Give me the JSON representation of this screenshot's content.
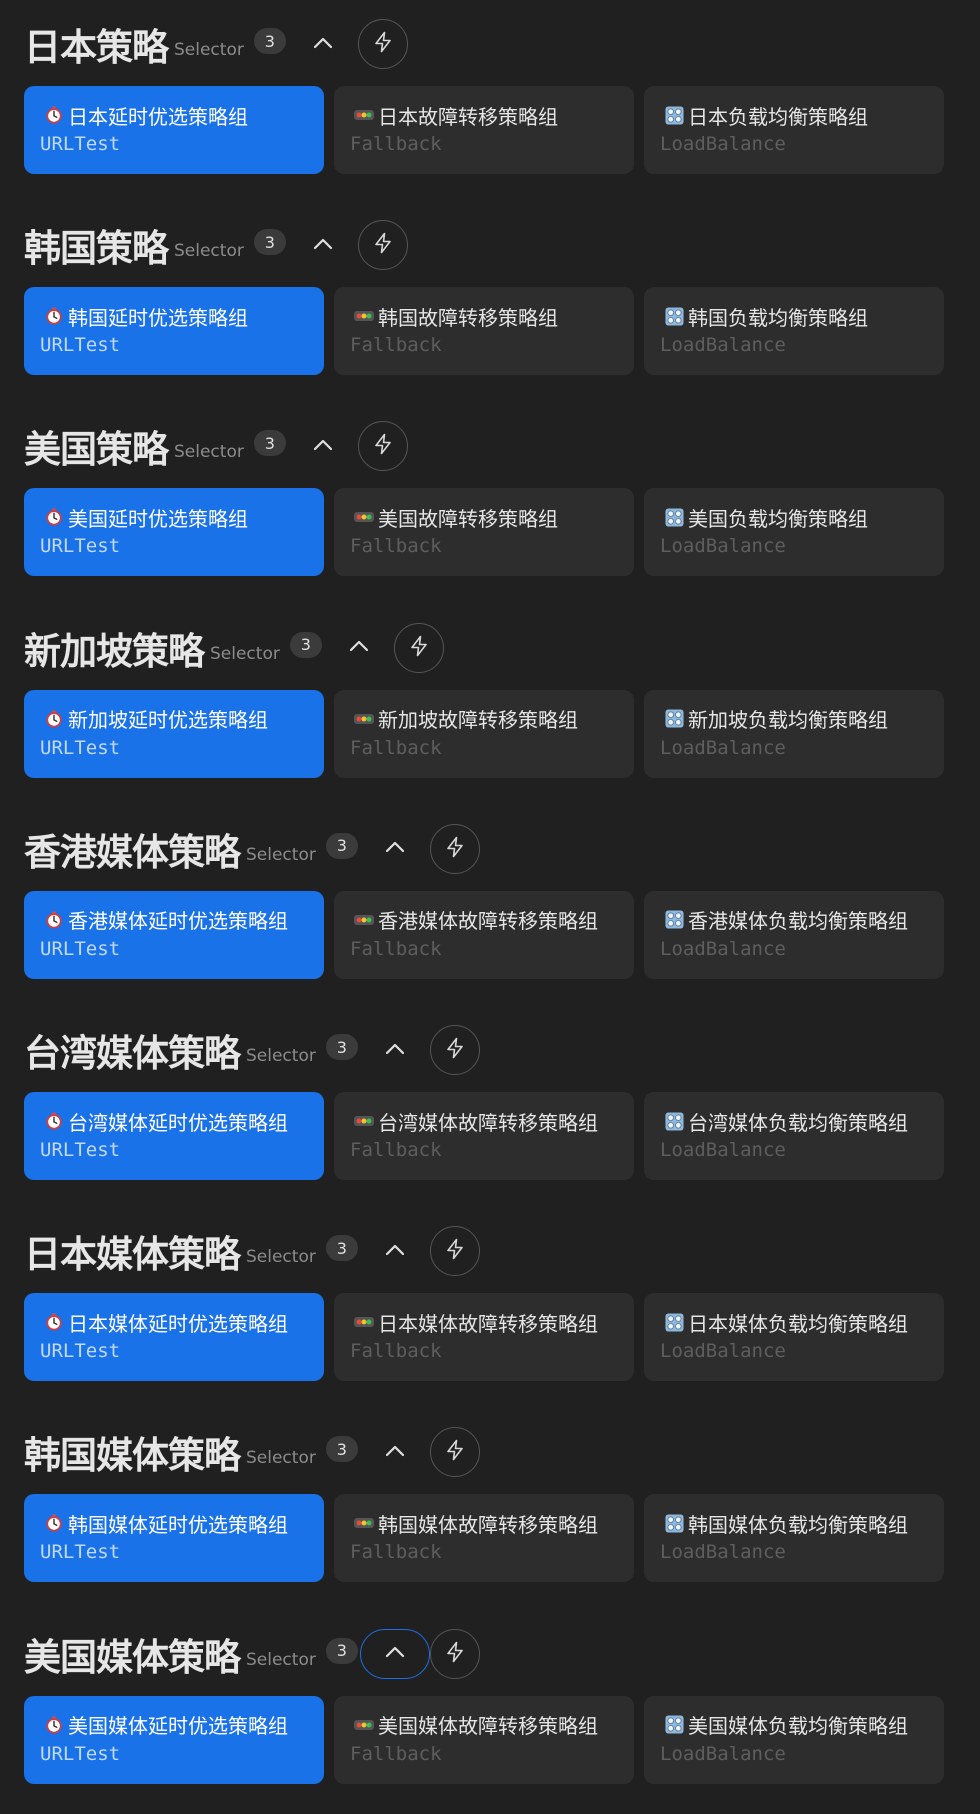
{
  "groups": [
    {
      "title": "日本策略",
      "type": "Selector",
      "count": "3",
      "collapse_focused": false,
      "proxies": [
        {
          "name": "日本延时优选策略组",
          "type": "URLTest",
          "icon": "stopwatch-icon",
          "selected": true
        },
        {
          "name": "日本故障转移策略组",
          "type": "Fallback",
          "icon": "traffic-light-icon",
          "selected": false
        },
        {
          "name": "日本负载均衡策略组",
          "type": "LoadBalance",
          "icon": "control-knobs-icon",
          "selected": false
        }
      ]
    },
    {
      "title": "韩国策略",
      "type": "Selector",
      "count": "3",
      "collapse_focused": false,
      "proxies": [
        {
          "name": "韩国延时优选策略组",
          "type": "URLTest",
          "icon": "stopwatch-icon",
          "selected": true
        },
        {
          "name": "韩国故障转移策略组",
          "type": "Fallback",
          "icon": "traffic-light-icon",
          "selected": false
        },
        {
          "name": "韩国负载均衡策略组",
          "type": "LoadBalance",
          "icon": "control-knobs-icon",
          "selected": false
        }
      ]
    },
    {
      "title": "美国策略",
      "type": "Selector",
      "count": "3",
      "collapse_focused": false,
      "proxies": [
        {
          "name": "美国延时优选策略组",
          "type": "URLTest",
          "icon": "stopwatch-icon",
          "selected": true
        },
        {
          "name": "美国故障转移策略组",
          "type": "Fallback",
          "icon": "traffic-light-icon",
          "selected": false
        },
        {
          "name": "美国负载均衡策略组",
          "type": "LoadBalance",
          "icon": "control-knobs-icon",
          "selected": false
        }
      ]
    },
    {
      "title": "新加坡策略",
      "type": "Selector",
      "count": "3",
      "collapse_focused": false,
      "proxies": [
        {
          "name": "新加坡延时优选策略组",
          "type": "URLTest",
          "icon": "stopwatch-icon",
          "selected": true
        },
        {
          "name": "新加坡故障转移策略组",
          "type": "Fallback",
          "icon": "traffic-light-icon",
          "selected": false
        },
        {
          "name": "新加坡负载均衡策略组",
          "type": "LoadBalance",
          "icon": "control-knobs-icon",
          "selected": false
        }
      ]
    },
    {
      "title": "香港媒体策略",
      "type": "Selector",
      "count": "3",
      "collapse_focused": false,
      "proxies": [
        {
          "name": "香港媒体延时优选策略组",
          "type": "URLTest",
          "icon": "stopwatch-icon",
          "selected": true
        },
        {
          "name": "香港媒体故障转移策略组",
          "type": "Fallback",
          "icon": "traffic-light-icon",
          "selected": false
        },
        {
          "name": "香港媒体负载均衡策略组",
          "type": "LoadBalance",
          "icon": "control-knobs-icon",
          "selected": false
        }
      ]
    },
    {
      "title": "台湾媒体策略",
      "type": "Selector",
      "count": "3",
      "collapse_focused": false,
      "proxies": [
        {
          "name": "台湾媒体延时优选策略组",
          "type": "URLTest",
          "icon": "stopwatch-icon",
          "selected": true
        },
        {
          "name": "台湾媒体故障转移策略组",
          "type": "Fallback",
          "icon": "traffic-light-icon",
          "selected": false
        },
        {
          "name": "台湾媒体负载均衡策略组",
          "type": "LoadBalance",
          "icon": "control-knobs-icon",
          "selected": false
        }
      ]
    },
    {
      "title": "日本媒体策略",
      "type": "Selector",
      "count": "3",
      "collapse_focused": false,
      "proxies": [
        {
          "name": "日本媒体延时优选策略组",
          "type": "URLTest",
          "icon": "stopwatch-icon",
          "selected": true
        },
        {
          "name": "日本媒体故障转移策略组",
          "type": "Fallback",
          "icon": "traffic-light-icon",
          "selected": false
        },
        {
          "name": "日本媒体负载均衡策略组",
          "type": "LoadBalance",
          "icon": "control-knobs-icon",
          "selected": false
        }
      ]
    },
    {
      "title": "韩国媒体策略",
      "type": "Selector",
      "count": "3",
      "collapse_focused": false,
      "proxies": [
        {
          "name": "韩国媒体延时优选策略组",
          "type": "URLTest",
          "icon": "stopwatch-icon",
          "selected": true
        },
        {
          "name": "韩国媒体故障转移策略组",
          "type": "Fallback",
          "icon": "traffic-light-icon",
          "selected": false
        },
        {
          "name": "韩国媒体负载均衡策略组",
          "type": "LoadBalance",
          "icon": "control-knobs-icon",
          "selected": false
        }
      ]
    },
    {
      "title": "美国媒体策略",
      "type": "Selector",
      "count": "3",
      "collapse_focused": true,
      "proxies": [
        {
          "name": "美国媒体延时优选策略组",
          "type": "URLTest",
          "icon": "stopwatch-icon",
          "selected": true
        },
        {
          "name": "美国媒体故障转移策略组",
          "type": "Fallback",
          "icon": "traffic-light-icon",
          "selected": false
        },
        {
          "name": "美国媒体负载均衡策略组",
          "type": "LoadBalance",
          "icon": "control-knobs-icon",
          "selected": false
        }
      ]
    }
  ],
  "colors": {
    "background": "#202020",
    "accent": "#1a72e8",
    "card": "#2d2d2d",
    "focus_ring": "#1d6fe6"
  }
}
